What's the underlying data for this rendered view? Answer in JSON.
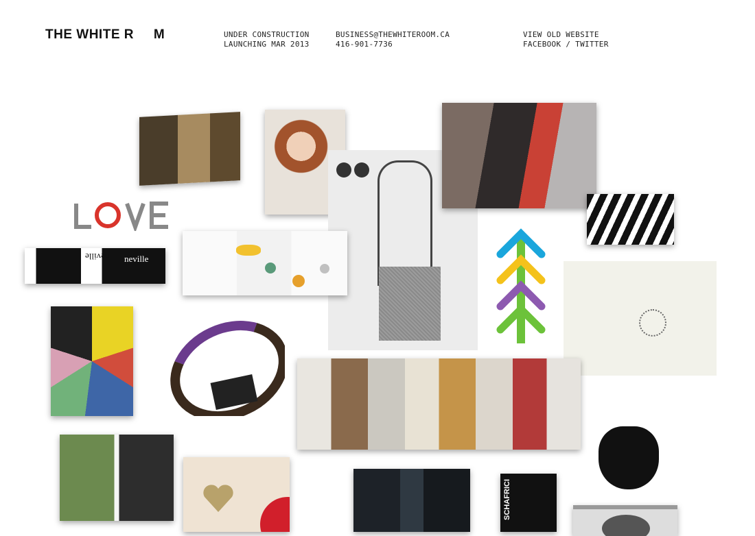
{
  "header": {
    "logo": "THE WHITE R     M",
    "status_line1": "UNDER CONSTRUCTION",
    "status_line2": "LAUNCHING MAR 2013",
    "email": "BUSINESS@THEWHITEROOM.CA",
    "phone": "416-901-7736",
    "old_site": "VIEW OLD WEBSITE",
    "facebook": "FACEBOOK",
    "separator": " / ",
    "twitter": "TWITTER"
  },
  "portfolio": {
    "neville_text_1": "neville",
    "neville_text_2": "neville",
    "spine_text": "SCHAFRICI",
    "colors": {
      "arrow_blue": "#1aa6dc",
      "arrow_yellow": "#f4c21b",
      "arrow_purple": "#8d5ab0",
      "arrow_green": "#6cc23a",
      "love_red": "#d9342b"
    }
  }
}
